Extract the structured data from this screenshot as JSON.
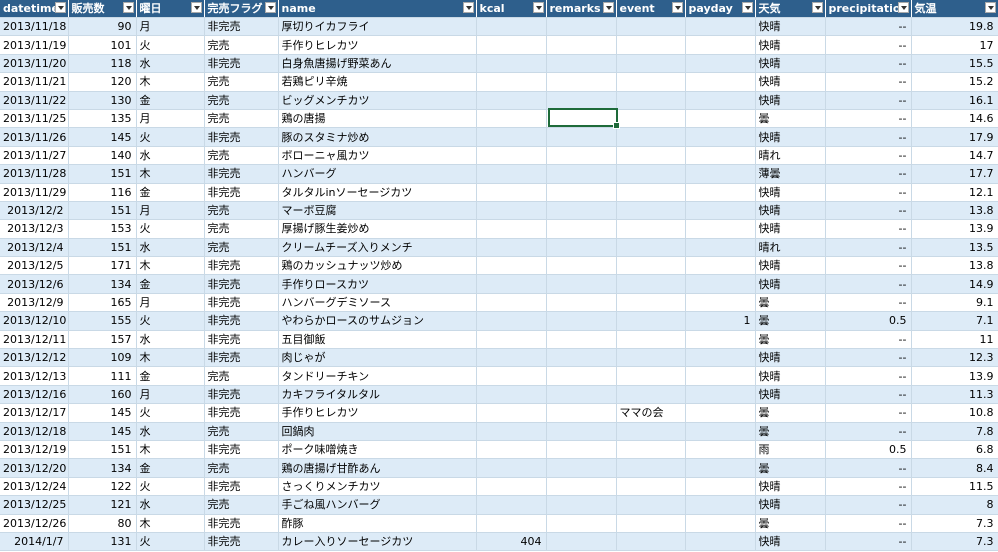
{
  "headers": [
    "datetime",
    "販売数",
    "曜日",
    "完売フラグ",
    "name",
    "kcal",
    "remarks",
    "event",
    "payday",
    "天気",
    "precipitation",
    "気温"
  ],
  "rows": [
    [
      "2013/11/18",
      "90",
      "月",
      "非完売",
      "厚切りイカフライ",
      "",
      "",
      "",
      "",
      "快晴",
      "--",
      "19.8"
    ],
    [
      "2013/11/19",
      "101",
      "火",
      "完売",
      "手作りヒレカツ",
      "",
      "",
      "",
      "",
      "快晴",
      "--",
      "17"
    ],
    [
      "2013/11/20",
      "118",
      "水",
      "非完売",
      "白身魚唐揚げ野菜あん",
      "",
      "",
      "",
      "",
      "快晴",
      "--",
      "15.5"
    ],
    [
      "2013/11/21",
      "120",
      "木",
      "完売",
      "若鶏ピリ辛焼",
      "",
      "",
      "",
      "",
      "快晴",
      "--",
      "15.2"
    ],
    [
      "2013/11/22",
      "130",
      "金",
      "完売",
      "ビッグメンチカツ",
      "",
      "",
      "",
      "",
      "快晴",
      "--",
      "16.1"
    ],
    [
      "2013/11/25",
      "135",
      "月",
      "完売",
      "鶏の唐揚",
      "",
      "",
      "",
      "",
      "曇",
      "--",
      "14.6"
    ],
    [
      "2013/11/26",
      "145",
      "火",
      "非完売",
      "豚のスタミナ炒め",
      "",
      "",
      "",
      "",
      "快晴",
      "--",
      "17.9"
    ],
    [
      "2013/11/27",
      "140",
      "水",
      "完売",
      "ボローニャ風カツ",
      "",
      "",
      "",
      "",
      "晴れ",
      "--",
      "14.7"
    ],
    [
      "2013/11/28",
      "151",
      "木",
      "非完売",
      "ハンバーグ",
      "",
      "",
      "",
      "",
      "薄曇",
      "--",
      "17.7"
    ],
    [
      "2013/11/29",
      "116",
      "金",
      "非完売",
      "タルタルinソーセージカツ",
      "",
      "",
      "",
      "",
      "快晴",
      "--",
      "12.1"
    ],
    [
      "2013/12/2",
      "151",
      "月",
      "完売",
      "マーボ豆腐",
      "",
      "",
      "",
      "",
      "快晴",
      "--",
      "13.8"
    ],
    [
      "2013/12/3",
      "153",
      "火",
      "完売",
      "厚揚げ豚生姜炒め",
      "",
      "",
      "",
      "",
      "快晴",
      "--",
      "13.9"
    ],
    [
      "2013/12/4",
      "151",
      "水",
      "完売",
      "クリームチーズ入りメンチ",
      "",
      "",
      "",
      "",
      "晴れ",
      "--",
      "13.5"
    ],
    [
      "2013/12/5",
      "171",
      "木",
      "非完売",
      "鶏のカッシュナッツ炒め",
      "",
      "",
      "",
      "",
      "快晴",
      "--",
      "13.8"
    ],
    [
      "2013/12/6",
      "134",
      "金",
      "非完売",
      "手作りロースカツ",
      "",
      "",
      "",
      "",
      "快晴",
      "--",
      "14.9"
    ],
    [
      "2013/12/9",
      "165",
      "月",
      "非完売",
      "ハンバーグデミソース",
      "",
      "",
      "",
      "",
      "曇",
      "--",
      "9.1"
    ],
    [
      "2013/12/10",
      "155",
      "火",
      "非完売",
      "やわらかロースのサムジョン",
      "",
      "",
      "",
      "1",
      "曇",
      "0.5",
      "7.1"
    ],
    [
      "2013/12/11",
      "157",
      "水",
      "非完売",
      "五目御飯",
      "",
      "",
      "",
      "",
      "曇",
      "--",
      "11"
    ],
    [
      "2013/12/12",
      "109",
      "木",
      "非完売",
      "肉じゃが",
      "",
      "",
      "",
      "",
      "快晴",
      "--",
      "12.3"
    ],
    [
      "2013/12/13",
      "111",
      "金",
      "完売",
      "タンドリーチキン",
      "",
      "",
      "",
      "",
      "快晴",
      "--",
      "13.9"
    ],
    [
      "2013/12/16",
      "160",
      "月",
      "非完売",
      "カキフライタルタル",
      "",
      "",
      "",
      "",
      "快晴",
      "--",
      "11.3"
    ],
    [
      "2013/12/17",
      "145",
      "火",
      "非完売",
      "手作りヒレカツ",
      "",
      "",
      "ママの会",
      "",
      "曇",
      "--",
      "10.8"
    ],
    [
      "2013/12/18",
      "145",
      "水",
      "完売",
      "回鍋肉",
      "",
      "",
      "",
      "",
      "曇",
      "--",
      "7.8"
    ],
    [
      "2013/12/19",
      "151",
      "木",
      "非完売",
      "ポーク味噌焼き",
      "",
      "",
      "",
      "",
      "雨",
      "0.5",
      "6.8"
    ],
    [
      "2013/12/20",
      "134",
      "金",
      "完売",
      "鶏の唐揚げ甘酢あん",
      "",
      "",
      "",
      "",
      "曇",
      "--",
      "8.4"
    ],
    [
      "2013/12/24",
      "122",
      "火",
      "非完売",
      "さっくりメンチカツ",
      "",
      "",
      "",
      "",
      "快晴",
      "--",
      "11.5"
    ],
    [
      "2013/12/25",
      "121",
      "水",
      "完売",
      "手ごね風ハンバーグ",
      "",
      "",
      "",
      "",
      "快晴",
      "--",
      "8"
    ],
    [
      "2013/12/26",
      "80",
      "木",
      "非完売",
      "酢豚",
      "",
      "",
      "",
      "",
      "曇",
      "--",
      "7.3"
    ],
    [
      "2014/1/7",
      "131",
      "火",
      "非完売",
      "カレー入りソーセージカツ",
      "404",
      "",
      "",
      "",
      "快晴",
      "--",
      "7.3"
    ]
  ]
}
